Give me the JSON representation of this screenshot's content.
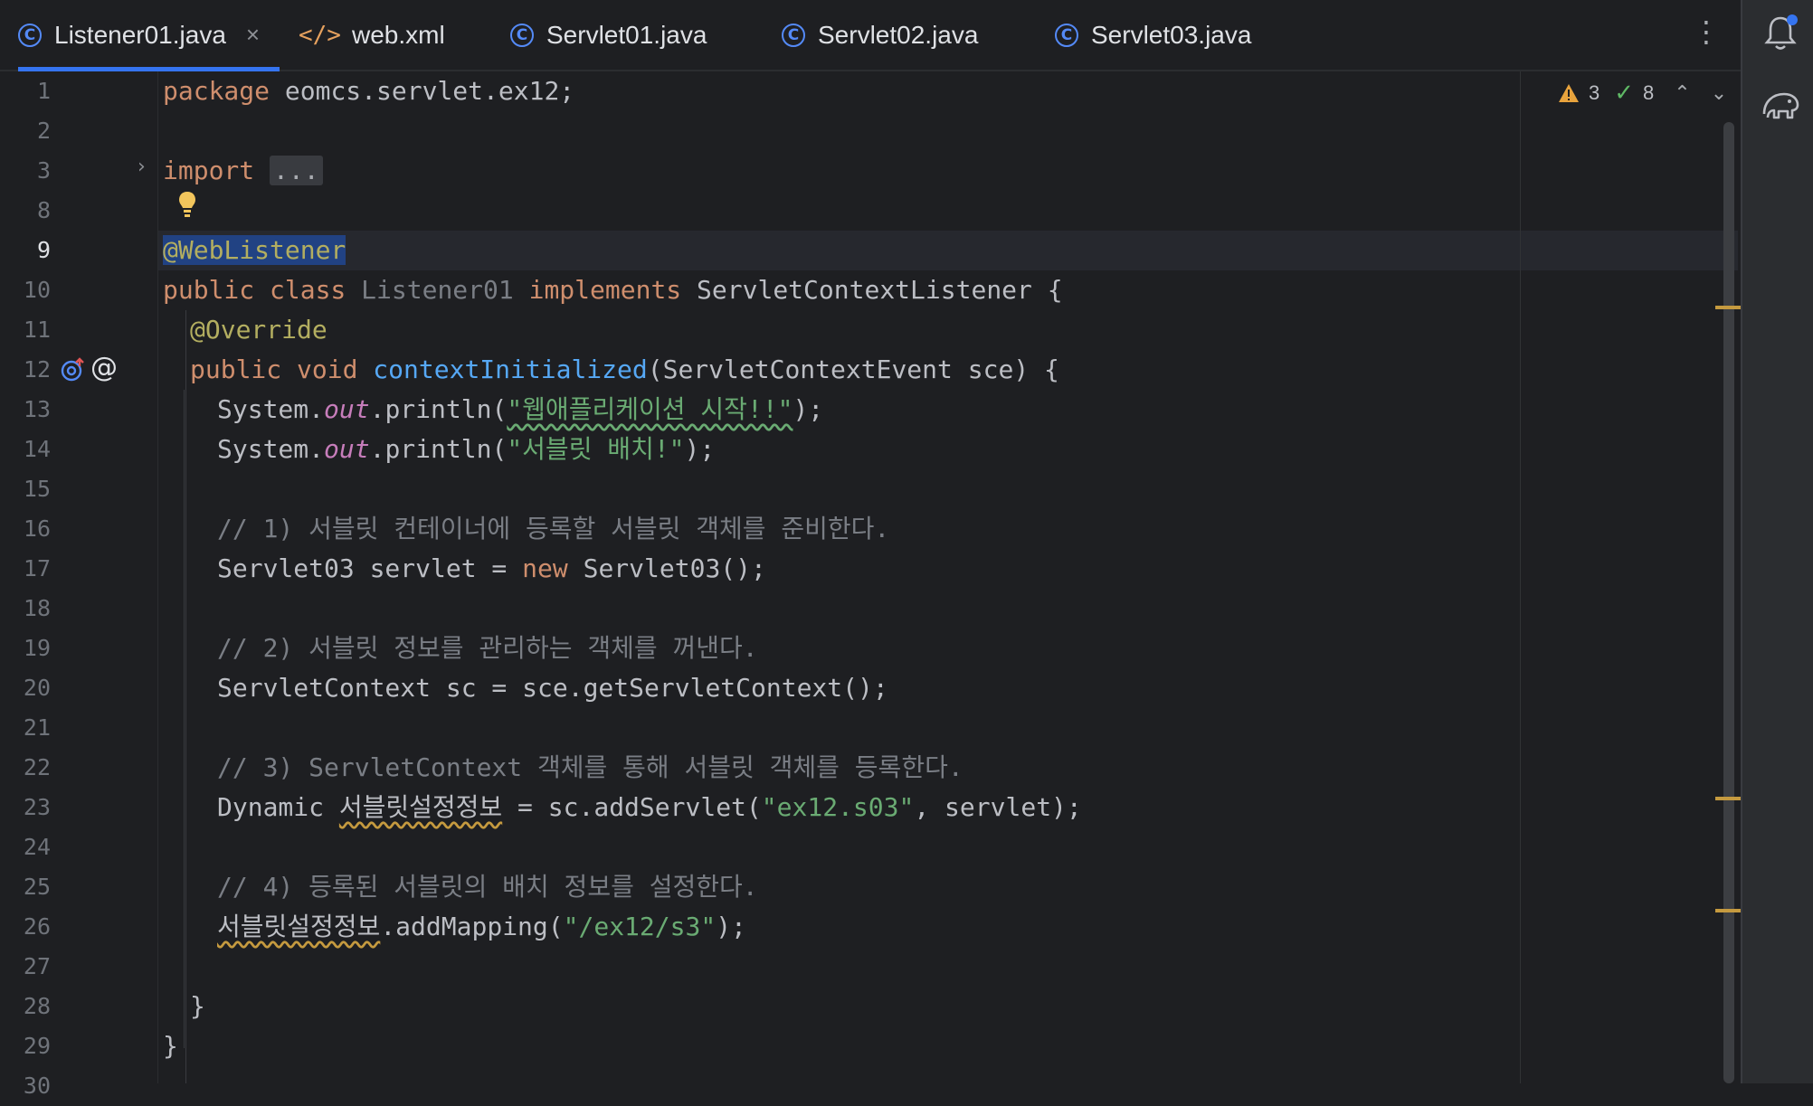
{
  "tabs": [
    {
      "label": "Listener01.java",
      "icon": "java-class-icon",
      "active": true
    },
    {
      "label": "web.xml",
      "icon": "xml-icon",
      "active": false
    },
    {
      "label": "Servlet01.java",
      "icon": "java-class-icon",
      "active": false
    },
    {
      "label": "Servlet02.java",
      "icon": "java-class-icon",
      "active": false
    },
    {
      "label": "Servlet03.java",
      "icon": "java-class-icon",
      "active": false
    }
  ],
  "inspection": {
    "warnings": "3",
    "checks": "8"
  },
  "line_numbers": [
    "1",
    "2",
    "3",
    "8",
    "9",
    "10",
    "11",
    "12",
    "13",
    "14",
    "15",
    "16",
    "17",
    "18",
    "19",
    "20",
    "21",
    "22",
    "23",
    "24",
    "25",
    "26",
    "27",
    "28",
    "29",
    "30"
  ],
  "code": {
    "l1_kw": "package",
    "l1_rest": " eomcs.servlet.ex12;",
    "l3_kw": "import",
    "l3_fold": "...",
    "l9_ann": "@WebListener",
    "l10_kw1": "public class",
    "l10_cls": "Listener01",
    "l10_kw2": "implements",
    "l10_rest": " ServletContextListener {",
    "l11_ann": "@Override",
    "l12_kw": "public void",
    "l12_fn": "contextInitialized",
    "l12_rest": "(ServletContextEvent sce) {",
    "l13_a": "System.",
    "l13_out": "out",
    "l13_b": ".println(",
    "l13_str": "\"웹애플리케이션 시작!!\"",
    "l13_c": ");",
    "l14_a": "System.",
    "l14_out": "out",
    "l14_b": ".println(",
    "l14_str": "\"서블릿 배치!\"",
    "l14_c": ");",
    "l16_cm": "// 1) 서블릿 컨테이너에 등록할 서블릿 객체를 준비한다.",
    "l17_a": "Servlet03 servlet = ",
    "l17_kw": "new",
    "l17_b": " Servlet03();",
    "l19_cm": "// 2) 서블릿 정보를 관리하는 객체를 꺼낸다.",
    "l20": "ServletContext sc = sce.getServletContext();",
    "l22_cm": "// 3) ServletContext 객체를 통해 서블릿 객체를 등록한다.",
    "l23_a": "Dynamic ",
    "l23_var": "서블릿설정정보",
    "l23_b": " = sc.addServlet(",
    "l23_str": "\"ex12.s03\"",
    "l23_c": ", servlet);",
    "l25_cm": "// 4) 등록된 서블릿의 배치 정보를 설정한다.",
    "l26_var": "서블릿설정정보",
    "l26_b": ".addMapping(",
    "l26_str": "\"/ex12/s3\"",
    "l26_c": ");",
    "l28": "}",
    "l29": "}"
  },
  "colors": {
    "background": "#1e1f22",
    "keyword": "#cf8e6d",
    "annotation": "#b3ae60",
    "method": "#56a8f5",
    "string": "#6aab73",
    "comment": "#7a7e85",
    "field": "#c77dbb",
    "accent": "#3574f0"
  }
}
